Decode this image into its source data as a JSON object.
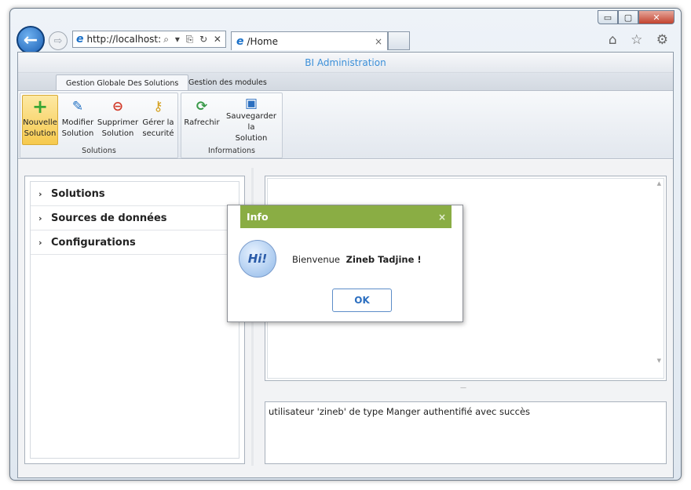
{
  "browser": {
    "url": "http://localhost:",
    "tab_title": "/Home",
    "tab_close": "×",
    "back_glyph": "←",
    "forward_glyph": "⇨",
    "addr_tools": "⌕ ▾ ⎘ ↻ ✕",
    "toolbar_icons": "⌂ ☆ ⚙",
    "window_buttons": {
      "minimize": "▭",
      "maximize": "▢",
      "close": "✕"
    }
  },
  "app": {
    "title": "BI Administration",
    "ribbon_tabs": [
      "Gestion Globale Des Solutions",
      "Gestion des modules"
    ],
    "groups": {
      "solutions": {
        "label": "Solutions",
        "buttons": [
          {
            "line1": "Nouvelle",
            "line2": "Solution",
            "icon": "+"
          },
          {
            "line1": "Modifier",
            "line2": "Solution",
            "icon": "✎"
          },
          {
            "line1": "Supprimer",
            "line2": "Solution",
            "icon": "⊖"
          },
          {
            "line1": "Gérer la",
            "line2": "securité",
            "icon": "⚷"
          }
        ]
      },
      "informations": {
        "label": "Informations",
        "buttons": [
          {
            "line1": "Rafrechir",
            "line2": "",
            "icon": "⟳"
          },
          {
            "line1": "Sauvegarder la",
            "line2": "Solution",
            "icon": "▣"
          }
        ]
      }
    },
    "accordion": [
      {
        "label": "Solutions",
        "chevron": "›"
      },
      {
        "label": "Sources de données",
        "chevron": "›"
      },
      {
        "label": "Configurations",
        "chevron": "›"
      }
    ],
    "status_message": "utilisateur 'zineb' de type Manger authentifié avec succès",
    "splitter_glyph": "—"
  },
  "dialog": {
    "title": "Info",
    "close": "×",
    "icon_text": "Hi!",
    "message": "Bienvenue",
    "user": "Zineb Tadjine !",
    "ok_label": "OK"
  }
}
